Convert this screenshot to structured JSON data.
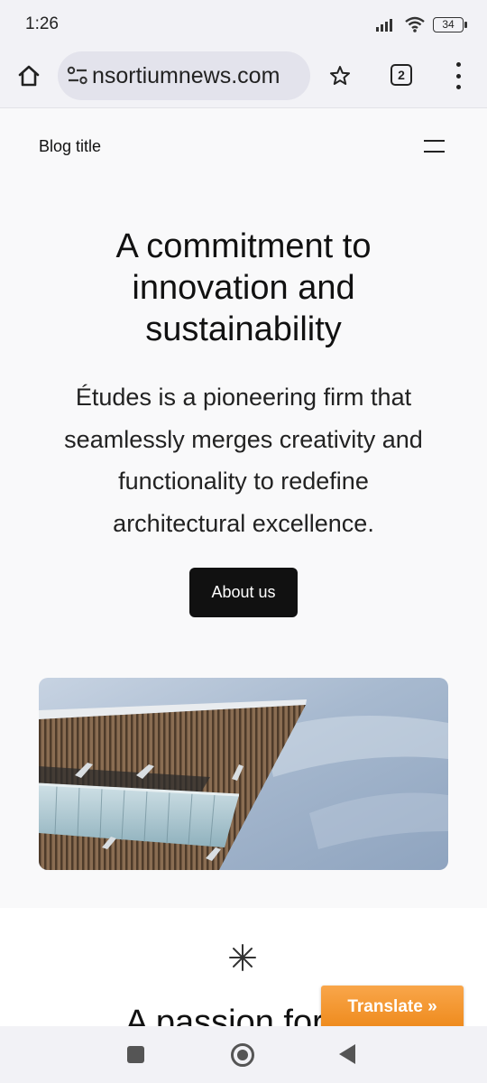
{
  "status_bar": {
    "time": "1:26",
    "battery": "34"
  },
  "browser": {
    "url": "nsortiumnews.com",
    "tab_count": "2"
  },
  "site_header": {
    "blog_title": "Blog title"
  },
  "hero": {
    "heading_lines": [
      "A commitment to",
      "innovation and",
      "sustainability"
    ],
    "body_lines": [
      "Études is a pioneering firm that",
      "seamlessly merges creativity and",
      "functionality to redefine",
      "architectural excellence."
    ],
    "button_label": "About us"
  },
  "section_two": {
    "heading": "A passion for cr"
  },
  "translate_widget": {
    "label": "Translate »",
    "color": "#f39a2e"
  },
  "icons": [
    "home-icon",
    "site-info-icon",
    "star-icon",
    "tabs-icon",
    "more-menu-icon",
    "hamburger-icon",
    "asterisk-icon",
    "wifi-icon",
    "signal-icon",
    "battery-icon"
  ]
}
